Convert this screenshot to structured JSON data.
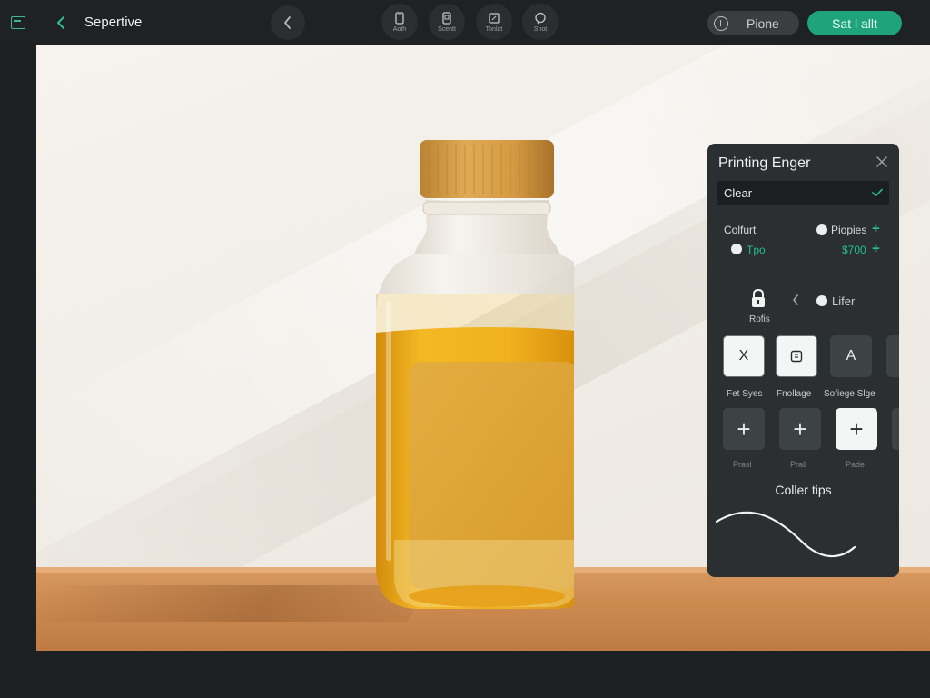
{
  "header": {
    "title": "Sepertive",
    "tools": [
      {
        "label": "Aoth",
        "icon": "phone-icon"
      },
      {
        "label": "Scentt",
        "icon": "mobile-scan-icon"
      },
      {
        "label": "Tonlat",
        "icon": "frame-icon"
      },
      {
        "label": "Shot",
        "icon": "chat-bubble-icon"
      }
    ],
    "phone_button": "Pione",
    "primary_button": "Sat l allt"
  },
  "panel": {
    "title": "Printing Enger",
    "select_value": "Clear",
    "options": {
      "left_top": "Colfurt",
      "left_bottom": "Tpo",
      "right_top": "Piopies",
      "right_bottom": "$700"
    },
    "lock_label": "Rofis",
    "radio_liter": "Lifer",
    "tiles_row1": [
      {
        "glyph": "X",
        "label": "Fet Syes"
      },
      {
        "glyph": "",
        "label": "Fnollage"
      },
      {
        "glyph": "A",
        "label": "Sofiege Slge"
      }
    ],
    "tiles_row2": [
      {
        "glyph": "+",
        "label": "Prasl"
      },
      {
        "glyph": "+",
        "label": "Prall"
      },
      {
        "glyph": "+",
        "label": "Pade"
      }
    ],
    "section_heading": "Coller tips"
  },
  "colors": {
    "accent": "#1fa37a",
    "accent_text": "#22c08a",
    "panel_bg": "#2b2f31",
    "app_bg": "#1e2123"
  }
}
